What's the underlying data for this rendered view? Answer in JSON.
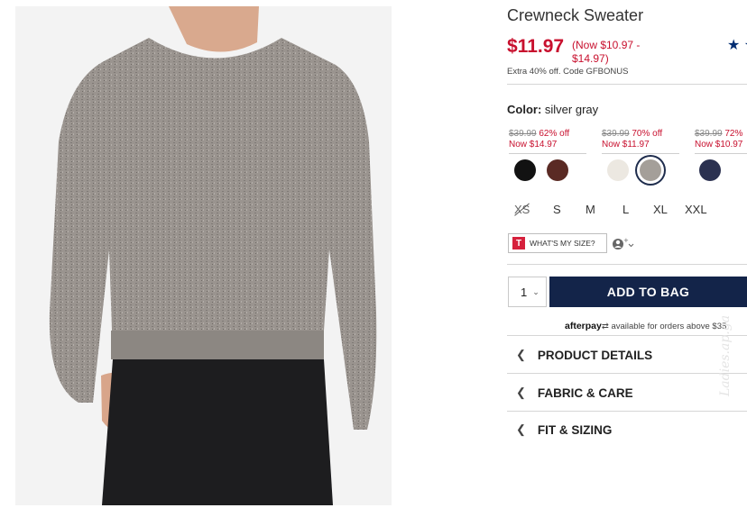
{
  "product": {
    "title": "Crewneck Sweater",
    "price": "$11.97",
    "price_range_line1": "(Now $10.97 -",
    "price_range_line2": "$14.97)",
    "promo": "Extra 40% off. Code GFBONUS",
    "rating_icon": "star-icon"
  },
  "color": {
    "label": "Color:",
    "value": "silver gray",
    "price_groups": [
      {
        "was": "$39.99",
        "off": "62% off",
        "now": "Now $14.97"
      },
      {
        "was": "$39.99",
        "off": "70% off",
        "now": "Now $11.97"
      },
      {
        "was": "$39.99",
        "off": "72%",
        "now": "Now $10.97"
      }
    ],
    "swatches": [
      {
        "color": "#121212"
      },
      {
        "color": "#5a2a24"
      },
      {
        "color": "#ece8e1"
      },
      {
        "color": "#a49f99",
        "selected": true
      },
      {
        "color": "#2b3150"
      }
    ]
  },
  "sizes": [
    "XS",
    "S",
    "M",
    "L",
    "XL",
    "XXL"
  ],
  "size_tool": {
    "icon": "T",
    "label": "WHAT'S MY SIZE?"
  },
  "cart": {
    "quantity": "1",
    "add_label": "ADD TO BAG"
  },
  "afterpay": {
    "brand": "afterpay",
    "text": "available for orders above $35"
  },
  "accordion": [
    "PRODUCT DETAILS",
    "FABRIC & CARE",
    "FIT & SIZING"
  ],
  "watermark": "Ladies.ap.ga"
}
